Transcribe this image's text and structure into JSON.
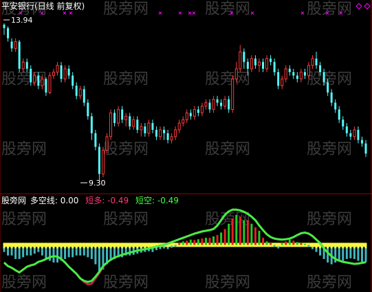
{
  "header": {
    "title": "平安银行(日线 前复权)",
    "title_color": "#ffffff"
  },
  "watermark": {
    "text": "股旁网",
    "color": "#3c3c3c"
  },
  "price_panel": {
    "max_label": "13.94",
    "min_label": "9.30",
    "up_color": "#ff3c3c",
    "down_color": "#54fcfc",
    "marker_color": "#ff00ff"
  },
  "indicator_header": {
    "name": "股旁网",
    "name_color": "#ffffff",
    "items": [
      {
        "label": "多空线: 0.00",
        "color": "#ffffff"
      },
      {
        "label": "短多: -0.49",
        "color": "#ff3c78"
      },
      {
        "label": "短空: -0.49",
        "color": "#44ff44"
      }
    ]
  },
  "chart_data": [
    {
      "type": "candlestick",
      "title": "平安银行(日线 前复权)",
      "annotations": [
        {
          "text": "13.94",
          "meaning": "highest price"
        },
        {
          "text": "9.30",
          "meaning": "lowest price"
        }
      ],
      "ylim": [
        9.2,
        14.1
      ],
      "candles": [
        [
          13.9,
          13.8,
          13.94,
          13.6
        ],
        [
          13.8,
          13.5,
          13.85,
          13.4
        ],
        [
          13.4,
          13.2,
          13.5,
          13.1
        ],
        [
          13.2,
          13.4,
          13.5,
          13.1
        ],
        [
          13.4,
          12.6,
          13.45,
          12.5
        ],
        [
          12.6,
          12.8,
          12.9,
          12.5
        ],
        [
          12.8,
          12.6,
          12.9,
          12.5
        ],
        [
          12.6,
          12.2,
          12.7,
          12.1
        ],
        [
          12.2,
          12.4,
          12.5,
          12.1
        ],
        [
          12.4,
          12.1,
          12.5,
          12.0
        ],
        [
          12.1,
          12.3,
          12.4,
          12.0
        ],
        [
          12.3,
          11.9,
          12.35,
          11.8
        ],
        [
          11.9,
          12.4,
          12.5,
          11.85
        ],
        [
          12.4,
          12.5,
          12.6,
          12.3
        ],
        [
          12.5,
          12.7,
          12.8,
          12.4
        ],
        [
          12.7,
          12.3,
          12.8,
          12.2
        ],
        [
          12.3,
          12.6,
          12.7,
          12.2
        ],
        [
          12.6,
          12.4,
          12.7,
          12.3
        ],
        [
          12.4,
          12.1,
          12.5,
          12.0
        ],
        [
          12.1,
          11.8,
          12.2,
          11.7
        ],
        [
          11.8,
          12.0,
          12.1,
          11.7
        ],
        [
          12.0,
          11.6,
          12.1,
          11.5
        ],
        [
          11.6,
          11.2,
          11.7,
          11.1
        ],
        [
          11.2,
          10.7,
          11.3,
          10.5
        ],
        [
          10.7,
          10.3,
          10.8,
          10.2
        ],
        [
          10.3,
          9.5,
          10.4,
          9.3
        ],
        [
          9.5,
          10.2,
          10.3,
          9.4
        ],
        [
          10.2,
          10.6,
          10.7,
          10.1
        ],
        [
          10.6,
          11.3,
          11.4,
          10.5
        ],
        [
          11.3,
          11.0,
          11.4,
          10.9
        ],
        [
          11.0,
          11.4,
          11.5,
          10.9
        ],
        [
          11.4,
          11.1,
          11.5,
          11.0
        ],
        [
          11.1,
          11.2,
          11.3,
          10.9
        ],
        [
          11.2,
          10.9,
          11.3,
          10.8
        ],
        [
          10.9,
          11.1,
          11.2,
          10.8
        ],
        [
          11.1,
          10.8,
          11.2,
          10.7
        ],
        [
          10.8,
          10.9,
          11.0,
          10.6
        ],
        [
          10.9,
          10.7,
          11.0,
          10.6
        ],
        [
          10.7,
          11.0,
          11.1,
          10.6
        ],
        [
          11.0,
          10.8,
          11.1,
          10.7
        ],
        [
          10.8,
          10.6,
          10.9,
          10.5
        ],
        [
          10.6,
          10.8,
          10.9,
          10.5
        ],
        [
          10.8,
          10.7,
          10.9,
          10.5
        ],
        [
          10.7,
          10.5,
          10.8,
          10.4
        ],
        [
          10.5,
          10.6,
          10.7,
          10.4
        ],
        [
          10.6,
          10.8,
          10.9,
          10.5
        ],
        [
          10.8,
          11.0,
          11.1,
          10.7
        ],
        [
          11.0,
          11.1,
          11.2,
          10.9
        ],
        [
          11.1,
          11.3,
          11.4,
          11.0
        ],
        [
          11.3,
          11.2,
          11.4,
          11.1
        ],
        [
          11.2,
          11.4,
          11.5,
          11.1
        ],
        [
          11.4,
          11.3,
          11.5,
          11.2
        ],
        [
          11.3,
          11.5,
          11.6,
          11.2
        ],
        [
          11.5,
          11.6,
          11.7,
          11.4
        ],
        [
          11.6,
          11.4,
          11.7,
          11.3
        ],
        [
          11.4,
          11.7,
          11.8,
          11.3
        ],
        [
          11.7,
          11.6,
          11.8,
          11.5
        ],
        [
          11.6,
          11.5,
          11.7,
          11.4
        ],
        [
          11.5,
          11.7,
          11.8,
          11.4
        ],
        [
          11.7,
          11.4,
          11.8,
          11.3
        ],
        [
          11.4,
          12.3,
          12.4,
          11.3
        ],
        [
          12.3,
          12.6,
          12.8,
          12.2
        ],
        [
          12.6,
          13.1,
          13.3,
          12.5
        ],
        [
          13.1,
          12.8,
          13.2,
          12.6
        ],
        [
          12.8,
          12.6,
          12.9,
          12.4
        ],
        [
          12.6,
          12.9,
          13.0,
          12.5
        ],
        [
          12.9,
          12.7,
          13.0,
          12.6
        ],
        [
          12.7,
          12.8,
          12.9,
          12.5
        ],
        [
          12.8,
          12.6,
          12.9,
          12.5
        ],
        [
          12.6,
          12.9,
          13.0,
          12.5
        ],
        [
          12.9,
          12.8,
          13.0,
          12.7
        ],
        [
          12.8,
          12.5,
          12.9,
          12.4
        ],
        [
          12.5,
          12.1,
          12.6,
          12.0
        ],
        [
          12.1,
          12.3,
          12.4,
          12.0
        ],
        [
          12.3,
          12.6,
          12.7,
          12.2
        ],
        [
          12.6,
          12.5,
          12.7,
          12.4
        ],
        [
          12.5,
          12.4,
          12.6,
          12.3
        ],
        [
          12.4,
          12.3,
          12.5,
          12.2
        ],
        [
          12.3,
          12.5,
          12.6,
          12.2
        ],
        [
          12.5,
          12.4,
          12.6,
          12.3
        ],
        [
          12.4,
          12.7,
          12.8,
          12.3
        ],
        [
          12.7,
          12.9,
          13.0,
          12.6
        ],
        [
          12.9,
          12.7,
          13.1,
          12.6
        ],
        [
          12.7,
          12.5,
          12.8,
          12.4
        ],
        [
          12.5,
          12.2,
          12.6,
          12.1
        ],
        [
          12.2,
          11.9,
          12.3,
          11.8
        ],
        [
          11.9,
          11.6,
          12.0,
          11.5
        ],
        [
          11.6,
          11.4,
          11.7,
          11.3
        ],
        [
          11.4,
          11.1,
          11.5,
          11.0
        ],
        [
          11.1,
          10.9,
          11.2,
          10.8
        ],
        [
          10.9,
          10.7,
          11.0,
          10.6
        ],
        [
          10.7,
          10.6,
          10.8,
          10.5
        ],
        [
          10.6,
          10.8,
          10.9,
          10.5
        ],
        [
          10.8,
          10.5,
          10.9,
          10.4
        ],
        [
          10.5,
          10.4,
          10.6,
          10.3
        ],
        [
          10.4,
          10.1,
          10.5,
          10.0
        ]
      ]
    },
    {
      "type": "bar+line",
      "title": "股旁网",
      "annotations": [
        "多空线: 0.00",
        "短多: -0.49",
        "短空: -0.49"
      ],
      "ylim": [
        -1.2,
        1.1
      ],
      "baseline": 0,
      "hist": [
        -0.2,
        -0.3,
        -0.3,
        -0.4,
        -0.4,
        -0.35,
        -0.3,
        -0.3,
        -0.25,
        -0.2,
        -0.3,
        -0.4,
        -0.45,
        -0.5,
        -0.5,
        -0.45,
        -0.4,
        -0.35,
        -0.35,
        -0.3,
        -0.3,
        -0.3,
        -0.35,
        -0.4,
        -0.55,
        -0.75,
        -0.7,
        -0.55,
        -0.45,
        -0.4,
        -0.35,
        -0.35,
        -0.3,
        -0.3,
        -0.28,
        -0.25,
        -0.22,
        -0.2,
        -0.18,
        -0.2,
        -0.15,
        -0.12,
        -0.1,
        -0.12,
        -0.08,
        -0.05,
        0.05,
        0.1,
        0.12,
        0.15,
        0.14,
        0.16,
        0.18,
        0.2,
        0.2,
        0.24,
        0.28,
        0.35,
        0.45,
        0.6,
        0.75,
        0.85,
        0.8,
        0.7,
        0.7,
        0.6,
        0.5,
        0.4,
        0.2,
        0.1,
        0.05,
        -0.05,
        -0.1,
        0.05,
        0.1,
        0.15,
        0.12,
        0.08,
        0.05,
        0.03,
        -0.05,
        -0.12,
        -0.2,
        -0.3,
        -0.4,
        -0.5,
        -0.55,
        -0.5,
        -0.45,
        -0.45,
        -0.4,
        -0.38,
        -0.4,
        -0.45,
        -0.48,
        -0.49
      ],
      "short_long": [
        -0.5,
        -0.6,
        -0.65,
        -0.72,
        -0.78,
        -0.7,
        -0.62,
        -0.58,
        -0.55,
        -0.48,
        -0.45,
        -0.4,
        -0.35,
        -0.32,
        -0.33,
        -0.4,
        -0.5,
        -0.62,
        -0.72,
        -0.82,
        -0.95,
        -1.05,
        -1.12,
        -1.1,
        -0.95,
        -0.8,
        -0.62,
        -0.5,
        -0.42,
        -0.36,
        -0.32,
        -0.28,
        -0.25,
        -0.22,
        -0.19,
        -0.16,
        -0.14,
        -0.12,
        -0.1,
        -0.08,
        -0.05,
        -0.02,
        0.0,
        0.04,
        0.08,
        0.12,
        0.16,
        0.2,
        0.24,
        0.28,
        0.32,
        0.35,
        0.38,
        0.4,
        0.42,
        0.45,
        0.55,
        0.7,
        0.85,
        0.95,
        1.0,
        1.0,
        0.98,
        0.94,
        0.88,
        0.8,
        0.7,
        0.55,
        0.42,
        0.3,
        0.22,
        0.18,
        0.16,
        0.15,
        0.16,
        0.18,
        0.22,
        0.28,
        0.33,
        0.35,
        0.32,
        0.25,
        0.15,
        0.05,
        -0.1,
        -0.22,
        -0.32,
        -0.4,
        -0.45,
        -0.48,
        -0.5,
        -0.52,
        -0.54,
        -0.53,
        -0.51,
        -0.49
      ],
      "short_short": [
        -0.5,
        -0.6,
        -0.65,
        -0.72,
        -0.78,
        -0.7,
        -0.62,
        -0.58,
        -0.55,
        -0.48,
        -0.45,
        -0.4,
        -0.35,
        -0.32,
        -0.33,
        -0.4,
        -0.5,
        -0.62,
        -0.72,
        -0.82,
        -0.95,
        -1.02,
        -1.05,
        -1.02,
        -0.9,
        -0.76,
        -0.6,
        -0.5,
        -0.42,
        -0.36,
        -0.32,
        -0.28,
        -0.25,
        -0.22,
        -0.19,
        -0.16,
        -0.14,
        -0.12,
        -0.1,
        -0.08,
        -0.05,
        -0.02,
        0.0,
        0.04,
        0.08,
        0.12,
        0.16,
        0.2,
        0.24,
        0.28,
        0.32,
        0.35,
        0.38,
        0.4,
        0.42,
        0.45,
        0.55,
        0.7,
        0.85,
        0.95,
        1.0,
        1.0,
        0.98,
        0.94,
        0.88,
        0.8,
        0.7,
        0.55,
        0.42,
        0.3,
        0.22,
        0.18,
        0.16,
        0.15,
        0.16,
        0.18,
        0.22,
        0.28,
        0.33,
        0.35,
        0.32,
        0.25,
        0.15,
        0.05,
        -0.1,
        -0.22,
        -0.32,
        -0.4,
        -0.45,
        -0.48,
        -0.5,
        -0.52,
        -0.54,
        -0.53,
        -0.51,
        -0.49
      ],
      "colors": {
        "hist_pos_red": "#e82020",
        "hist_pos_green": "#22cc22",
        "hist_neg": "#40b8c0",
        "fill_yellow": "#f8f840",
        "line_short_long": "#c02050",
        "line_short_short": "#44ee44"
      }
    }
  ]
}
